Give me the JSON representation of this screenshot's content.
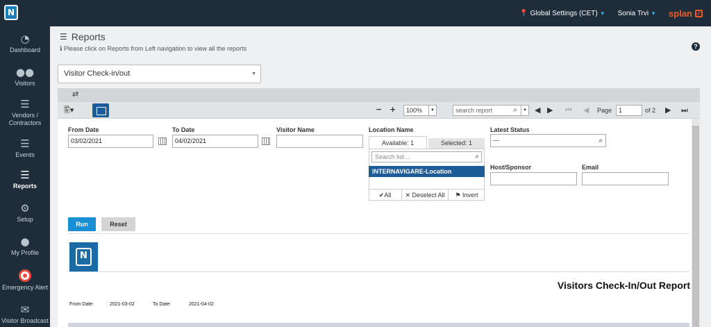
{
  "topbar": {
    "logo_text": "N",
    "global_settings": "Global Settings (CET)",
    "user_name": "Sonia Trvi",
    "brand": "splan"
  },
  "sidebar": {
    "items": [
      {
        "label": "Dashboard",
        "icon": "dashboard-icon"
      },
      {
        "label": "Visitors",
        "icon": "visitors-icon"
      },
      {
        "label": "Vendors / Contractors",
        "icon": "list-icon"
      },
      {
        "label": "Events",
        "icon": "list-icon"
      },
      {
        "label": "Reports",
        "icon": "reports-icon",
        "active": true
      },
      {
        "label": "Setup",
        "icon": "gear-icon"
      },
      {
        "label": "My Profile",
        "icon": "user-icon"
      },
      {
        "label": "Emergency Alert",
        "icon": "alert-icon"
      },
      {
        "label": "Visitor Broadcast",
        "icon": "mail-icon"
      }
    ]
  },
  "page": {
    "title": "Reports",
    "subtitle": "Please click on Reports from Left navigation to view all the reports",
    "help": "?"
  },
  "report_select": {
    "value": "Visitor Check-in/out"
  },
  "viewer_toolbar": {
    "zoom": "100%",
    "search_placeholder": "search report",
    "page_label": "Page",
    "page_value": "1",
    "page_of": "of 2"
  },
  "filters": {
    "from_date": {
      "label": "From Date",
      "value": "03/02/2021"
    },
    "to_date": {
      "label": "To Date",
      "value": "04/02/2021"
    },
    "visitor_name": {
      "label": "Visitor Name",
      "value": ""
    },
    "location": {
      "label": "Location Name",
      "available_tab": "Available: 1",
      "selected_tab": "Selected: 1",
      "search_placeholder": "Search list...",
      "items": [
        "INTERNAVIGARE-Location"
      ],
      "all": "All",
      "deselect_all": "Deselect All",
      "invert": "Invert"
    },
    "latest_status": {
      "label": "Latest Status",
      "value": "---"
    },
    "host_sponsor": {
      "label": "Host/Sponsor",
      "value": ""
    },
    "email": {
      "label": "Email",
      "value": ""
    }
  },
  "buttons": {
    "run": "Run",
    "reset": "Reset"
  },
  "report": {
    "title": "Visitors Check-In/Out Report",
    "from_date_label": "From Date:",
    "from_date_value": "2021-03-02",
    "to_date_label": "To Date:",
    "to_date_value": "2021-04-02"
  },
  "colors": {
    "sidebar": "#1f2d3a",
    "accent": "#1e5c99",
    "run": "#1a8fd3",
    "brand": "#f05a28"
  }
}
